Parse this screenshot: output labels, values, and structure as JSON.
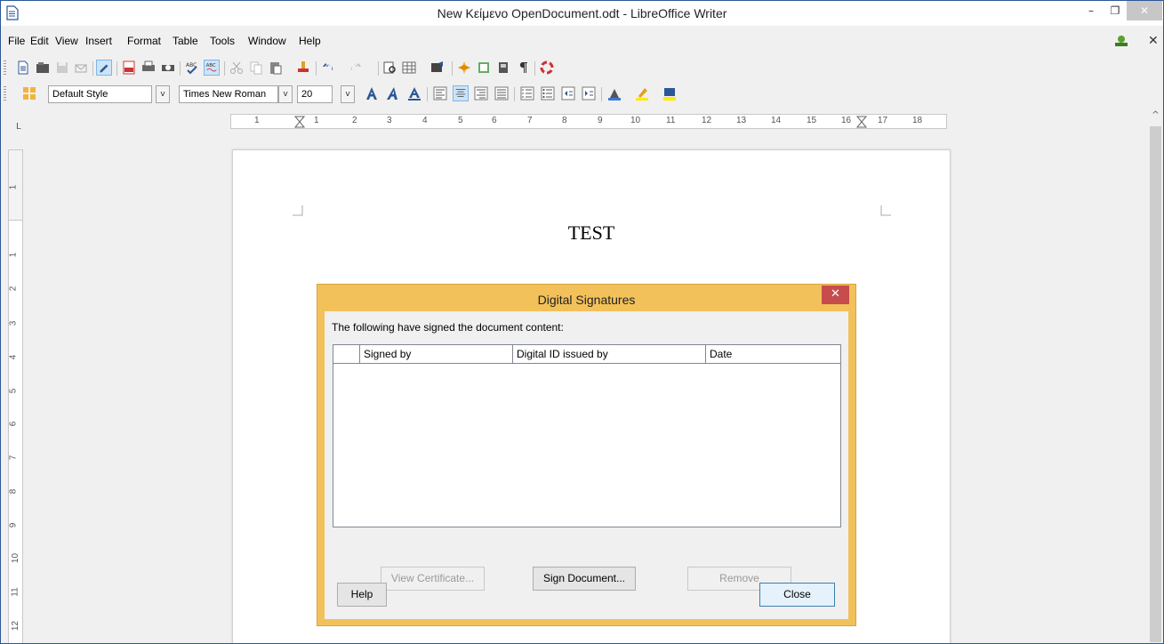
{
  "window": {
    "title": "New Κείμενο OpenDocument.odt - LibreOffice Writer",
    "minimize": "–",
    "maximize": "❐",
    "close": "✕"
  },
  "menu": {
    "items": [
      "File",
      "Edit",
      "View",
      "Insert",
      "Format",
      "Table",
      "Tools",
      "Window",
      "Help"
    ],
    "doc_close": "✕"
  },
  "formatting": {
    "paragraph_style": "Default Style",
    "font_name": "Times New Roman",
    "font_size": "20",
    "dropdown_glyph": "v"
  },
  "ruler": {
    "corner": "L",
    "h_numbers": [
      "1",
      "1",
      "2",
      "3",
      "4",
      "5",
      "6",
      "7",
      "8",
      "9",
      "10",
      "11",
      "12",
      "13",
      "14",
      "15",
      "16",
      "17",
      "18"
    ],
    "v_numbers": [
      "1",
      "1",
      "2",
      "3",
      "4",
      "5",
      "6",
      "7",
      "8",
      "9",
      "10",
      "11",
      "12"
    ]
  },
  "document": {
    "text": "TEST"
  },
  "scrollbar": {
    "up": "^"
  },
  "dialog": {
    "title": "Digital Signatures",
    "close": "✕",
    "label": "The following have signed the document content:",
    "columns": [
      "",
      "Signed by",
      "Digital ID issued by",
      "Date"
    ],
    "buttons": {
      "view_certificate": "View Certificate...",
      "sign_document": "Sign Document...",
      "remove": "Remove",
      "help": "Help",
      "close": "Close"
    }
  },
  "colors": {
    "dialog_frame": "#f2c15a",
    "dialog_close": "#c74d4d",
    "accent": "#2b5797"
  }
}
